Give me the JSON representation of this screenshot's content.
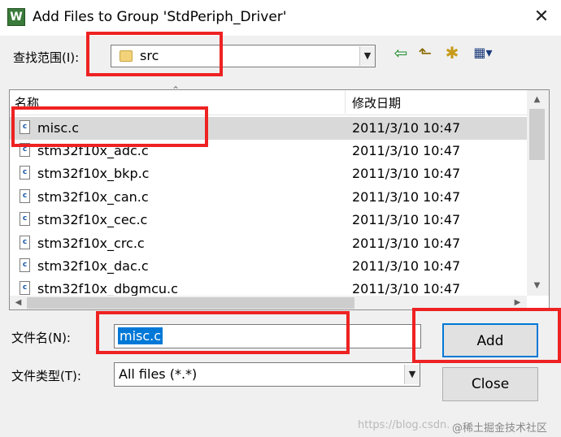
{
  "window": {
    "title": "Add Files to Group 'StdPeriph_Driver'",
    "close_glyph": "✕",
    "app_icon_glyph": "W"
  },
  "lookin": {
    "label": "查找范围(I):",
    "value": "src"
  },
  "toolbar": {
    "back_glyph": "⇦",
    "up_glyph": "⬑",
    "newfolder_glyph": "✱",
    "view_glyph": "▦▾"
  },
  "list": {
    "columns": {
      "name": "名称",
      "date": "修改日期"
    },
    "rows": [
      {
        "name": "misc.c",
        "date": "2011/3/10 10:47",
        "selected": true
      },
      {
        "name": "stm32f10x_adc.c",
        "date": "2011/3/10 10:47"
      },
      {
        "name": "stm32f10x_bkp.c",
        "date": "2011/3/10 10:47"
      },
      {
        "name": "stm32f10x_can.c",
        "date": "2011/3/10 10:47"
      },
      {
        "name": "stm32f10x_cec.c",
        "date": "2011/3/10 10:47"
      },
      {
        "name": "stm32f10x_crc.c",
        "date": "2011/3/10 10:47"
      },
      {
        "name": "stm32f10x_dac.c",
        "date": "2011/3/10 10:47"
      },
      {
        "name": "stm32f10x_dbgmcu.c",
        "date": "2011/3/10 10:47"
      }
    ]
  },
  "filename": {
    "label": "文件名(N):",
    "value": "misc.c"
  },
  "filetype": {
    "label": "文件类型(T):",
    "value": "All files (*.*)"
  },
  "buttons": {
    "add": "Add",
    "close": "Close"
  },
  "watermark": {
    "url": "https://blog.csdn.",
    "text": "@稀土掘金技术社区"
  },
  "colors": {
    "highlight": "#ee2222",
    "selection": "#0078d7"
  }
}
